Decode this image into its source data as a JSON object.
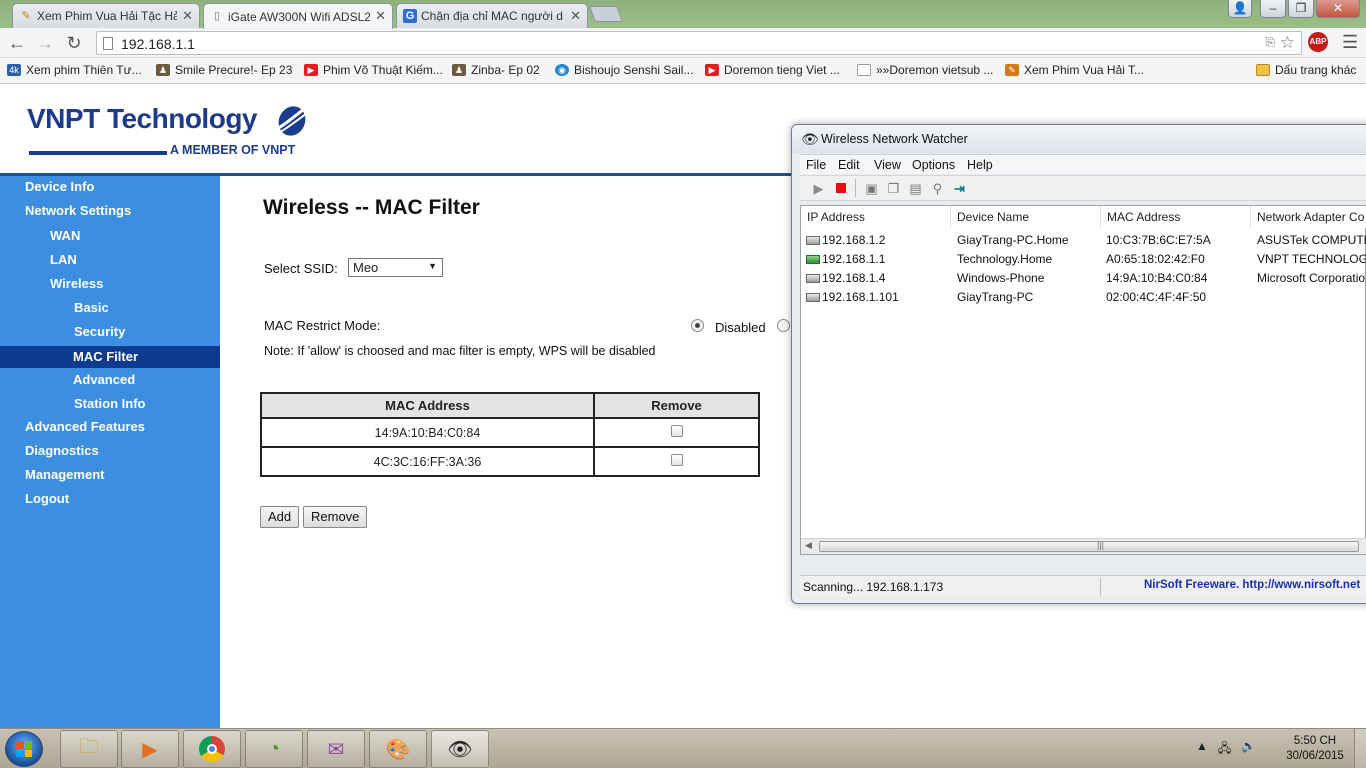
{
  "browser": {
    "tabs": [
      {
        "title": "Xem Phim Vua Hải Tặc Hả",
        "icon": "film-icon"
      },
      {
        "title": "iGate AW300N Wifi ADSL2",
        "icon": "page-icon"
      },
      {
        "title": "Chặn địa chỉ MAC người d",
        "icon": "g-icon"
      }
    ],
    "url": "192.168.1.1",
    "abp_label": "ABP",
    "bookmarks": [
      {
        "label": "Xem phim Thiên Tư...",
        "icon": "4k"
      },
      {
        "label": "Smile Precure!- Ep 23",
        "icon": "user"
      },
      {
        "label": "Phim Võ Thuật Kiếm...",
        "icon": "youtube"
      },
      {
        "label": "Zinba- Ep 02",
        "icon": "user"
      },
      {
        "label": "Bishoujo Senshi Sail...",
        "icon": "blue"
      },
      {
        "label": "Doremon tieng Viet ...",
        "icon": "youtube"
      },
      {
        "label": "»»Doremon vietsub ...",
        "icon": "page"
      },
      {
        "label": "Xem Phim Vua Hải T...",
        "icon": "film"
      }
    ],
    "other_bookmarks": "Dấu trang khác"
  },
  "router": {
    "brand": "VNPT Technology",
    "tagline": "A MEMBER OF VNPT",
    "nav": [
      {
        "label": "Device Info",
        "level": 0
      },
      {
        "label": "Network Settings",
        "level": 0
      },
      {
        "label": "WAN",
        "level": 1
      },
      {
        "label": "LAN",
        "level": 1
      },
      {
        "label": "Wireless",
        "level": 1
      },
      {
        "label": "Basic",
        "level": 2
      },
      {
        "label": "Security",
        "level": 2
      },
      {
        "label": "MAC Filter",
        "level": 2,
        "selected": true
      },
      {
        "label": "Advanced",
        "level": 2
      },
      {
        "label": "Station Info",
        "level": 2
      },
      {
        "label": "Advanced Features",
        "level": 0
      },
      {
        "label": "Diagnostics",
        "level": 0
      },
      {
        "label": "Management",
        "level": 0
      },
      {
        "label": "Logout",
        "level": 0
      }
    ],
    "title": "Wireless -- MAC Filter",
    "ssid_label": "Select SSID:",
    "ssid_value": "Meo",
    "restrict_label": "MAC Restrict Mode:",
    "restrict_option": "Disabled",
    "note": "Note: If 'allow' is choosed and mac filter is empty, WPS will be disabled",
    "table_headers": [
      "MAC Address",
      "Remove"
    ],
    "table_rows": [
      {
        "mac": "14:9A:10:B4:C0:84"
      },
      {
        "mac": "4C:3C:16:FF:3A:36"
      }
    ],
    "add_button": "Add",
    "remove_button": "Remove"
  },
  "watcher": {
    "title": "Wireless Network Watcher",
    "menu": [
      "File",
      "Edit",
      "View",
      "Options",
      "Help"
    ],
    "columns": [
      "IP Address",
      "Device Name",
      "MAC Address",
      "Network Adapter Co"
    ],
    "rows": [
      {
        "ip": "192.168.1.2",
        "name": "GiayTrang-PC.Home",
        "mac": "10:C3:7B:6C:E7:5A",
        "vendor": "ASUSTek COMPUTER",
        "green": false
      },
      {
        "ip": "192.168.1.1",
        "name": "Technology.Home",
        "mac": "A0:65:18:02:42:F0",
        "vendor": "VNPT TECHNOLOGY",
        "green": true
      },
      {
        "ip": "192.168.1.4",
        "name": "Windows-Phone",
        "mac": "14:9A:10:B4:C0:84",
        "vendor": "Microsoft Corporatio",
        "green": false
      },
      {
        "ip": "192.168.1.101",
        "name": "GiayTrang-PC",
        "mac": "02:00:4C:4F:4F:50",
        "vendor": "",
        "green": false
      }
    ],
    "status": "Scanning... 192.168.1.173",
    "credit": "NirSoft Freeware.  http://www.nirsoft.net"
  },
  "taskbar": {
    "time": "5:50 CH",
    "date": "30/06/2015"
  }
}
